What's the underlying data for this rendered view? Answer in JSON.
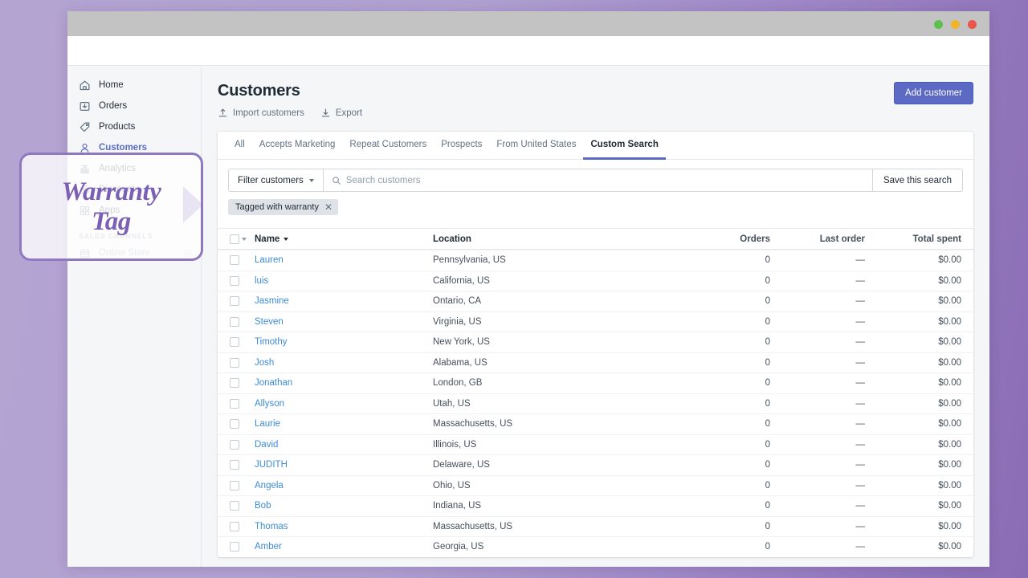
{
  "window": {
    "dots": [
      "green",
      "yellow",
      "red"
    ]
  },
  "sidebar": {
    "items": [
      {
        "label": "Home",
        "icon": "home-icon",
        "active": false
      },
      {
        "label": "Orders",
        "icon": "orders-icon",
        "active": false
      },
      {
        "label": "Products",
        "icon": "products-icon",
        "active": false
      },
      {
        "label": "Customers",
        "icon": "customers-icon",
        "active": true
      },
      {
        "label": "Analytics",
        "icon": "analytics-icon",
        "active": false
      },
      {
        "label": "Discounts",
        "icon": "discounts-icon",
        "active": false
      },
      {
        "label": "Apps",
        "icon": "apps-icon",
        "active": false
      }
    ],
    "section_header": "SALES CHANNELS",
    "channels": [
      {
        "label": "Online Store",
        "icon": "store-icon",
        "trailing_icon": "settings-icon"
      }
    ]
  },
  "header": {
    "title": "Customers",
    "add_customer_label": "Add customer",
    "links": [
      {
        "label": "Import customers",
        "icon": "upload-icon"
      },
      {
        "label": "Export",
        "icon": "download-icon"
      }
    ]
  },
  "tabs": [
    {
      "label": "All",
      "active": false
    },
    {
      "label": "Accepts Marketing",
      "active": false
    },
    {
      "label": "Repeat Customers",
      "active": false
    },
    {
      "label": "Prospects",
      "active": false
    },
    {
      "label": "From United States",
      "active": false
    },
    {
      "label": "Custom Search",
      "active": true
    }
  ],
  "filterbar": {
    "filter_label": "Filter customers",
    "search_placeholder": "Search customers",
    "search_value": "",
    "save_search_label": "Save this search",
    "search_icon": "search-icon"
  },
  "chips": [
    {
      "label": "Tagged with warranty",
      "remove_icon": "close-icon"
    }
  ],
  "table": {
    "columns": [
      "Name",
      "Location",
      "Orders",
      "Last order",
      "Total spent"
    ],
    "sorted_column": "Name",
    "rows": [
      {
        "name": "Lauren",
        "location": "Pennsylvania, US",
        "orders": "0",
        "last_order": "—",
        "total_spent": "$0.00"
      },
      {
        "name": "luis",
        "location": "California, US",
        "orders": "0",
        "last_order": "—",
        "total_spent": "$0.00"
      },
      {
        "name": "Jasmine",
        "location": "Ontario, CA",
        "orders": "0",
        "last_order": "—",
        "total_spent": "$0.00"
      },
      {
        "name": "Steven",
        "location": "Virginia, US",
        "orders": "0",
        "last_order": "—",
        "total_spent": "$0.00"
      },
      {
        "name": "Timothy",
        "location": "New York, US",
        "orders": "0",
        "last_order": "—",
        "total_spent": "$0.00"
      },
      {
        "name": "Josh",
        "location": "Alabama, US",
        "orders": "0",
        "last_order": "—",
        "total_spent": "$0.00"
      },
      {
        "name": "Jonathan",
        "location": "London, GB",
        "orders": "0",
        "last_order": "—",
        "total_spent": "$0.00"
      },
      {
        "name": "Allyson",
        "location": "Utah, US",
        "orders": "0",
        "last_order": "—",
        "total_spent": "$0.00"
      },
      {
        "name": "Laurie",
        "location": "Massachusetts, US",
        "orders": "0",
        "last_order": "—",
        "total_spent": "$0.00"
      },
      {
        "name": "David",
        "location": "Illinois, US",
        "orders": "0",
        "last_order": "—",
        "total_spent": "$0.00"
      },
      {
        "name": "JUDITH",
        "location": "Delaware, US",
        "orders": "0",
        "last_order": "—",
        "total_spent": "$0.00"
      },
      {
        "name": "Angela",
        "location": "Ohio, US",
        "orders": "0",
        "last_order": "—",
        "total_spent": "$0.00"
      },
      {
        "name": "Bob",
        "location": "Indiana, US",
        "orders": "0",
        "last_order": "—",
        "total_spent": "$0.00"
      },
      {
        "name": "Thomas",
        "location": "Massachusetts, US",
        "orders": "0",
        "last_order": "—",
        "total_spent": "$0.00"
      },
      {
        "name": "Amber",
        "location": "Georgia, US",
        "orders": "0",
        "last_order": "—",
        "total_spent": "$0.00"
      }
    ]
  },
  "callout": {
    "line1": "Warranty",
    "line2": "Tag",
    "border_color": "#8f78c0",
    "text_color": "#7a5fb5"
  },
  "colors": {
    "accent": "#5c6ac4",
    "link": "#3d8bd4",
    "page_background": "#b0a0d0",
    "chip_background": "#dfe3e8"
  }
}
